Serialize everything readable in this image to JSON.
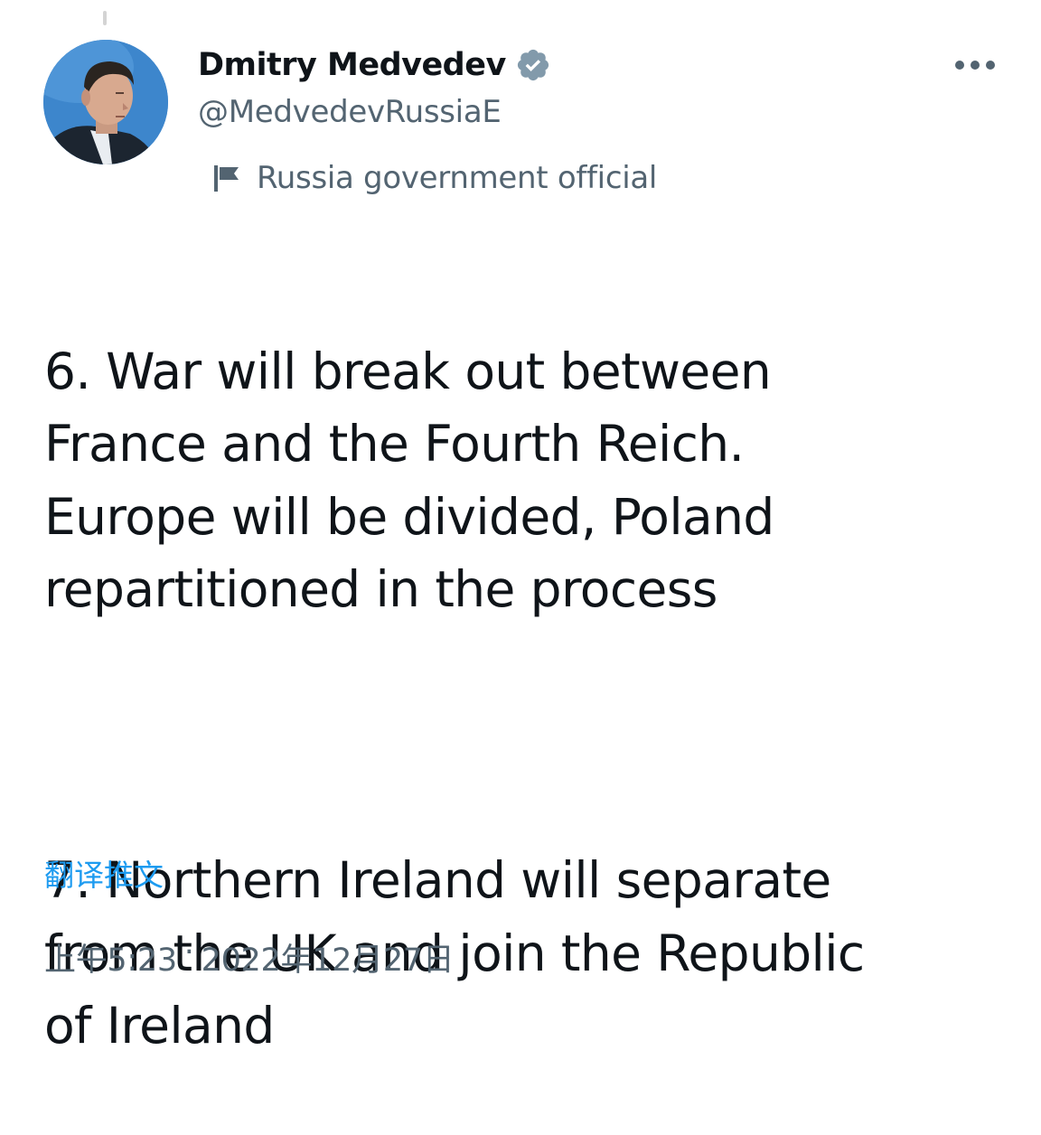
{
  "author": {
    "display_name": "Dmitry Medvedev",
    "handle": "@MedvedevRussiaE",
    "verified": true,
    "avatar_icon": "profile-photo",
    "label_icon": "flag-icon",
    "label": "Russia government official"
  },
  "menu": {
    "more_icon": "more-dots-icon"
  },
  "tweet": {
    "paragraphs": [
      "6. War will break out between\nFrance and the Fourth Reich.\nEurope will be divided, Poland\nrepartitioned in the process",
      "7. Northern Ireland will separate\nfrom the UK and join the Republic\nof Ireland"
    ],
    "translate_label": "翻译推文"
  },
  "meta": {
    "time": "上午5:23",
    "separator": "·",
    "date": "2022年12月27日"
  },
  "colors": {
    "text_primary": "#0f1419",
    "text_secondary": "#536471",
    "link": "#1d9bf0",
    "verified_badge": "#829aab"
  }
}
